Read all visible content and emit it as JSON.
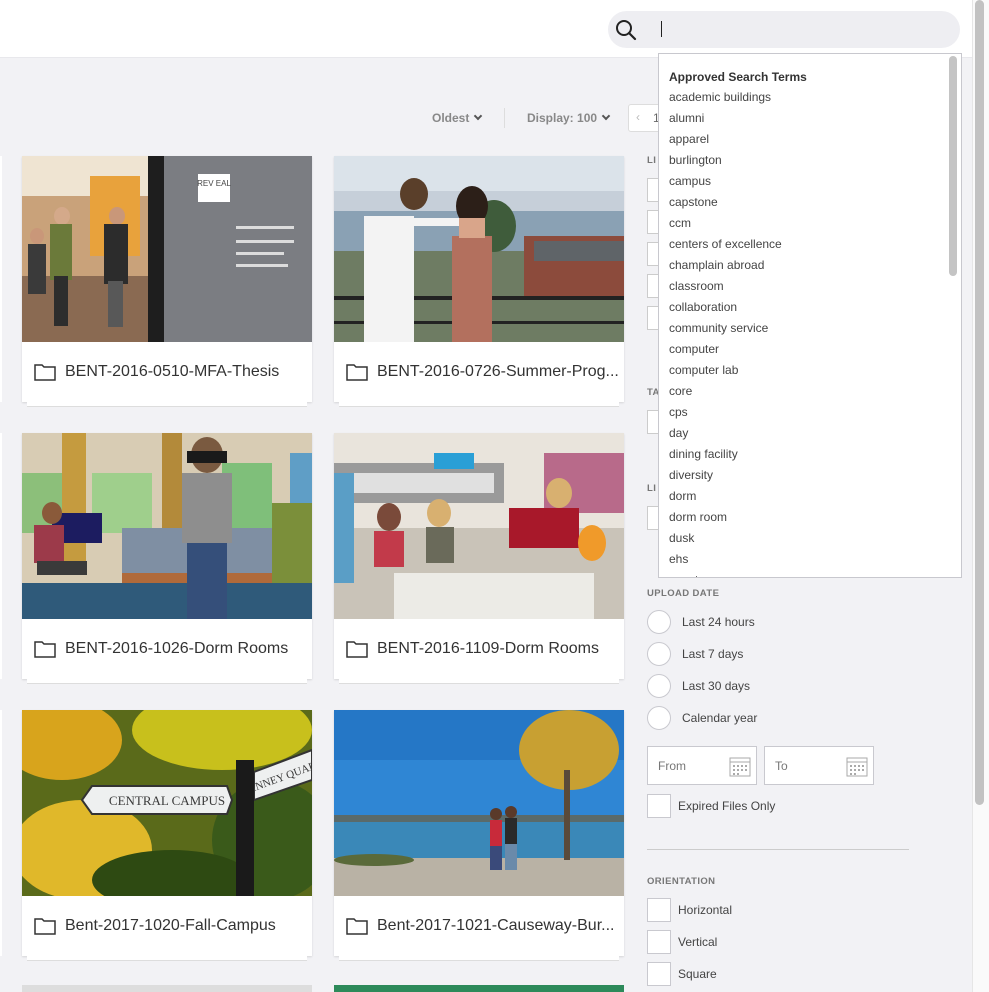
{
  "search": {
    "placeholder": "",
    "value": ""
  },
  "toolbar": {
    "sort_label": "Oldest",
    "display_label": "Display: 100",
    "page_number": "1"
  },
  "cards": [
    {
      "title": "BENT-2016-0510-MFA-Thesis",
      "reveal_text": "REV EAL"
    },
    {
      "title": "BENT-2016-0726-Summer-Prog..."
    },
    {
      "title": "BENT-2016-1026-Dorm Rooms"
    },
    {
      "title": "BENT-2016-1109-Dorm Rooms"
    },
    {
      "title": "Bent-2017-1020-Fall-Campus",
      "sign_text": "CENTRAL CAMPUS",
      "sign_text_2": "INNEY QUAD"
    },
    {
      "title": "Bent-2017-1021-Causeway-Bur..."
    }
  ],
  "dropdown": {
    "header": "Approved Search Terms",
    "items": [
      "academic buildings",
      "alumni",
      "apparel",
      "burlington",
      "campus",
      "capstone",
      "ccm",
      "centers of excellence",
      "champlain abroad",
      "classroom",
      "collaboration",
      "community service",
      "computer",
      "computer lab",
      "core",
      "cps",
      "day",
      "dining facility",
      "diversity",
      "dorm",
      "dorm room",
      "dusk",
      "ehs",
      "event"
    ]
  },
  "filters": {
    "partial_labels": [
      "LI",
      "TA",
      "LI"
    ],
    "upload_date": {
      "label": "UPLOAD DATE",
      "options": [
        "Last 24 hours",
        "Last 7 days",
        "Last 30 days",
        "Calendar year"
      ],
      "from_placeholder": "From",
      "to_placeholder": "To",
      "expired_label": "Expired Files Only"
    },
    "orientation": {
      "label": "ORIENTATION",
      "options": [
        "Horizontal",
        "Vertical",
        "Square"
      ]
    }
  }
}
